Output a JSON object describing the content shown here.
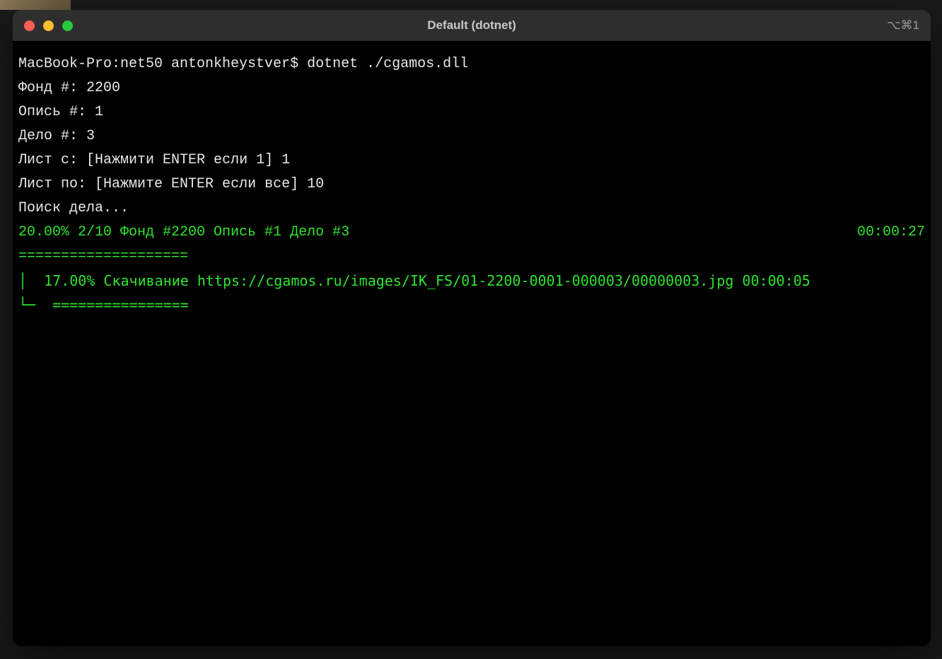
{
  "window": {
    "title": "Default (dotnet)",
    "shortcut_label": "⌥⌘1"
  },
  "terminal": {
    "prompt": "MacBook-Pro:net50 antonkheystver$ dotnet ./cgamos.dll",
    "inputs": {
      "fond_label": "Фонд #:",
      "fond_value": "2200",
      "opis_label": "Опись #:",
      "opis_value": "1",
      "delo_label": "Дело #:",
      "delo_value": "3",
      "list_from_label": "Лист с:",
      "list_from_hint": "[Нажмити ENTER если 1]",
      "list_from_value": "1",
      "list_to_label": "Лист по:",
      "list_to_hint": "[Нажмите ENTER если все]",
      "list_to_value": "10"
    },
    "status": {
      "searching": "Поиск дела...",
      "overall_progress": "20.00% 2/10 Фонд #2200 Опись #1 Дело #3",
      "overall_time": "00:00:27",
      "separator1": "====================",
      "download_line": "  17.00% Скачивание https://cgamos.ru/images/IK_FS/01-2200-0001-000003/00000003.jpg 00:00:05",
      "separator2": "  ================"
    }
  }
}
